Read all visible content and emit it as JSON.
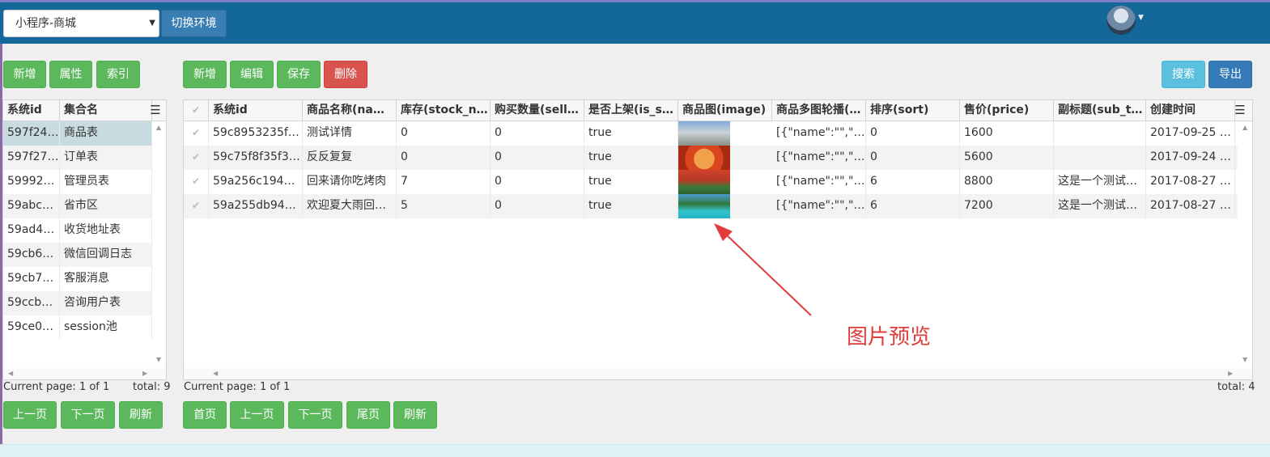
{
  "header": {
    "env_select_value": "小程序-商城",
    "env_switch_label": "切换环境"
  },
  "left_toolbar": {
    "add": "新增",
    "props": "属性",
    "index": "索引"
  },
  "right_toolbar": {
    "add": "新增",
    "edit": "编辑",
    "save": "保存",
    "delete": "删除",
    "search": "搜索",
    "export": "导出"
  },
  "collections": {
    "headers": [
      "系统id",
      "集合名"
    ],
    "rows": [
      [
        "597f24…",
        "商品表"
      ],
      [
        "597f27…",
        "订单表"
      ],
      [
        "59992…",
        "管理员表"
      ],
      [
        "59abc…",
        "省市区"
      ],
      [
        "59ad4…",
        "收货地址表"
      ],
      [
        "59cb6…",
        "微信回调日志"
      ],
      [
        "59cb7…",
        "客服消息"
      ],
      [
        "59ccb…",
        "咨询用户表"
      ],
      [
        "59ce0…",
        "session池"
      ]
    ],
    "pager_text": "Current page: 1 of 1",
    "total_text": "total: 9"
  },
  "products": {
    "headers": [
      "系统id",
      "商品名称(nam…",
      "库存(stock_n…",
      "购买数量(sell…",
      "是否上架(is_s…",
      "商品图(image)",
      "商品多图轮播(…",
      "排序(sort)",
      "售价(price)",
      "副标题(sub_ti…",
      "创建时间"
    ],
    "rows": [
      [
        "59c8953235f3…",
        "测试详情",
        "0",
        "0",
        "true",
        "",
        "[{\"name\":\"\",\"ur…",
        "0",
        "1600",
        "",
        "2017-09-25 1…"
      ],
      [
        "59c75f8f35f3f…",
        "反反复复",
        "0",
        "0",
        "true",
        "",
        "[{\"name\":\"\",\"ur…",
        "0",
        "5600",
        "",
        "2017-09-24 1…"
      ],
      [
        "59a256c194a…",
        "回来请你吃烤肉",
        "7",
        "0",
        "true",
        "",
        "[{\"name\":\"\",\"ur…",
        "6",
        "8800",
        "这是一个测试…",
        "2017-08-27 1…"
      ],
      [
        "59a255db94a…",
        "欢迎夏大雨回…",
        "5",
        "0",
        "true",
        "",
        "[{\"name\":\"\",\"ur…",
        "6",
        "7200",
        "这是一个测试…",
        "2017-08-27 1…"
      ]
    ],
    "pager_text": "Current page: 1 of 1",
    "total_text": "total: 4"
  },
  "left_pager": {
    "prev": "上一页",
    "next": "下一页",
    "refresh": "刷新"
  },
  "right_pager": {
    "first": "首页",
    "prev": "上一页",
    "next": "下一页",
    "last": "尾页",
    "refresh": "刷新"
  },
  "annotation": {
    "text": "图片预览"
  },
  "colors": {
    "header_bg": "#136799",
    "primary_green": "#5cb85c",
    "danger_red": "#d9534f",
    "annotation_red": "#e03c3c"
  }
}
